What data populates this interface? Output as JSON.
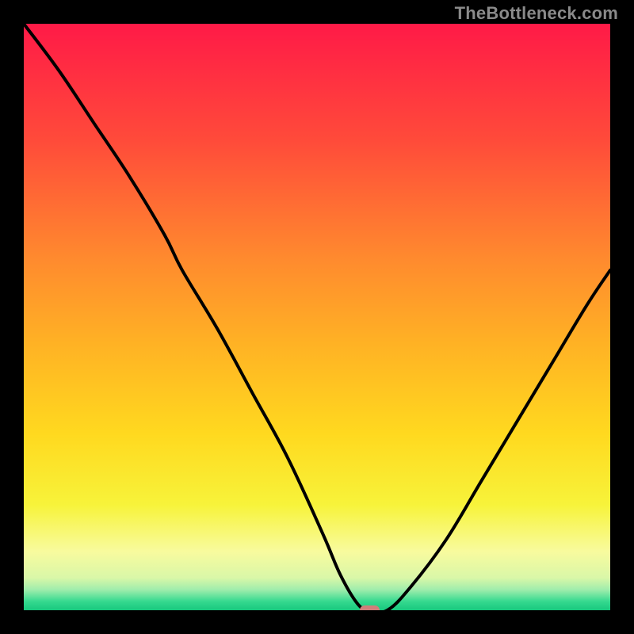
{
  "watermark": "TheBottleneck.com",
  "colors": {
    "frame": "#000000",
    "curve": "#000000",
    "marker": "#cf7e7a",
    "gradient_stops": [
      {
        "offset": 0.0,
        "color": "#ff1a47"
      },
      {
        "offset": 0.2,
        "color": "#ff4b3a"
      },
      {
        "offset": 0.4,
        "color": "#ff8a2e"
      },
      {
        "offset": 0.55,
        "color": "#ffb324"
      },
      {
        "offset": 0.7,
        "color": "#ffd91f"
      },
      {
        "offset": 0.82,
        "color": "#f7f33a"
      },
      {
        "offset": 0.9,
        "color": "#f8fb9e"
      },
      {
        "offset": 0.945,
        "color": "#d9f7a8"
      },
      {
        "offset": 0.965,
        "color": "#9fedac"
      },
      {
        "offset": 0.985,
        "color": "#35d98f"
      },
      {
        "offset": 1.0,
        "color": "#18c87e"
      }
    ]
  },
  "chart_data": {
    "type": "line",
    "title": "",
    "xlabel": "",
    "ylabel": "",
    "xlim": [
      0,
      100
    ],
    "ylim": [
      0,
      100
    ],
    "optimum_x": 59,
    "series": [
      {
        "name": "bottleneck-curve",
        "x": [
          0,
          6,
          12,
          18,
          24,
          27,
          33,
          39,
          45,
          51,
          54,
          57,
          59,
          62,
          66,
          72,
          78,
          84,
          90,
          96,
          100
        ],
        "values": [
          100,
          92,
          83,
          74,
          64,
          58,
          48,
          37,
          26,
          13,
          6,
          1,
          0,
          0,
          4,
          12,
          22,
          32,
          42,
          52,
          58
        ]
      }
    ],
    "marker": {
      "x": 59,
      "y": 0,
      "w": 3.4,
      "h": 1.6
    }
  }
}
